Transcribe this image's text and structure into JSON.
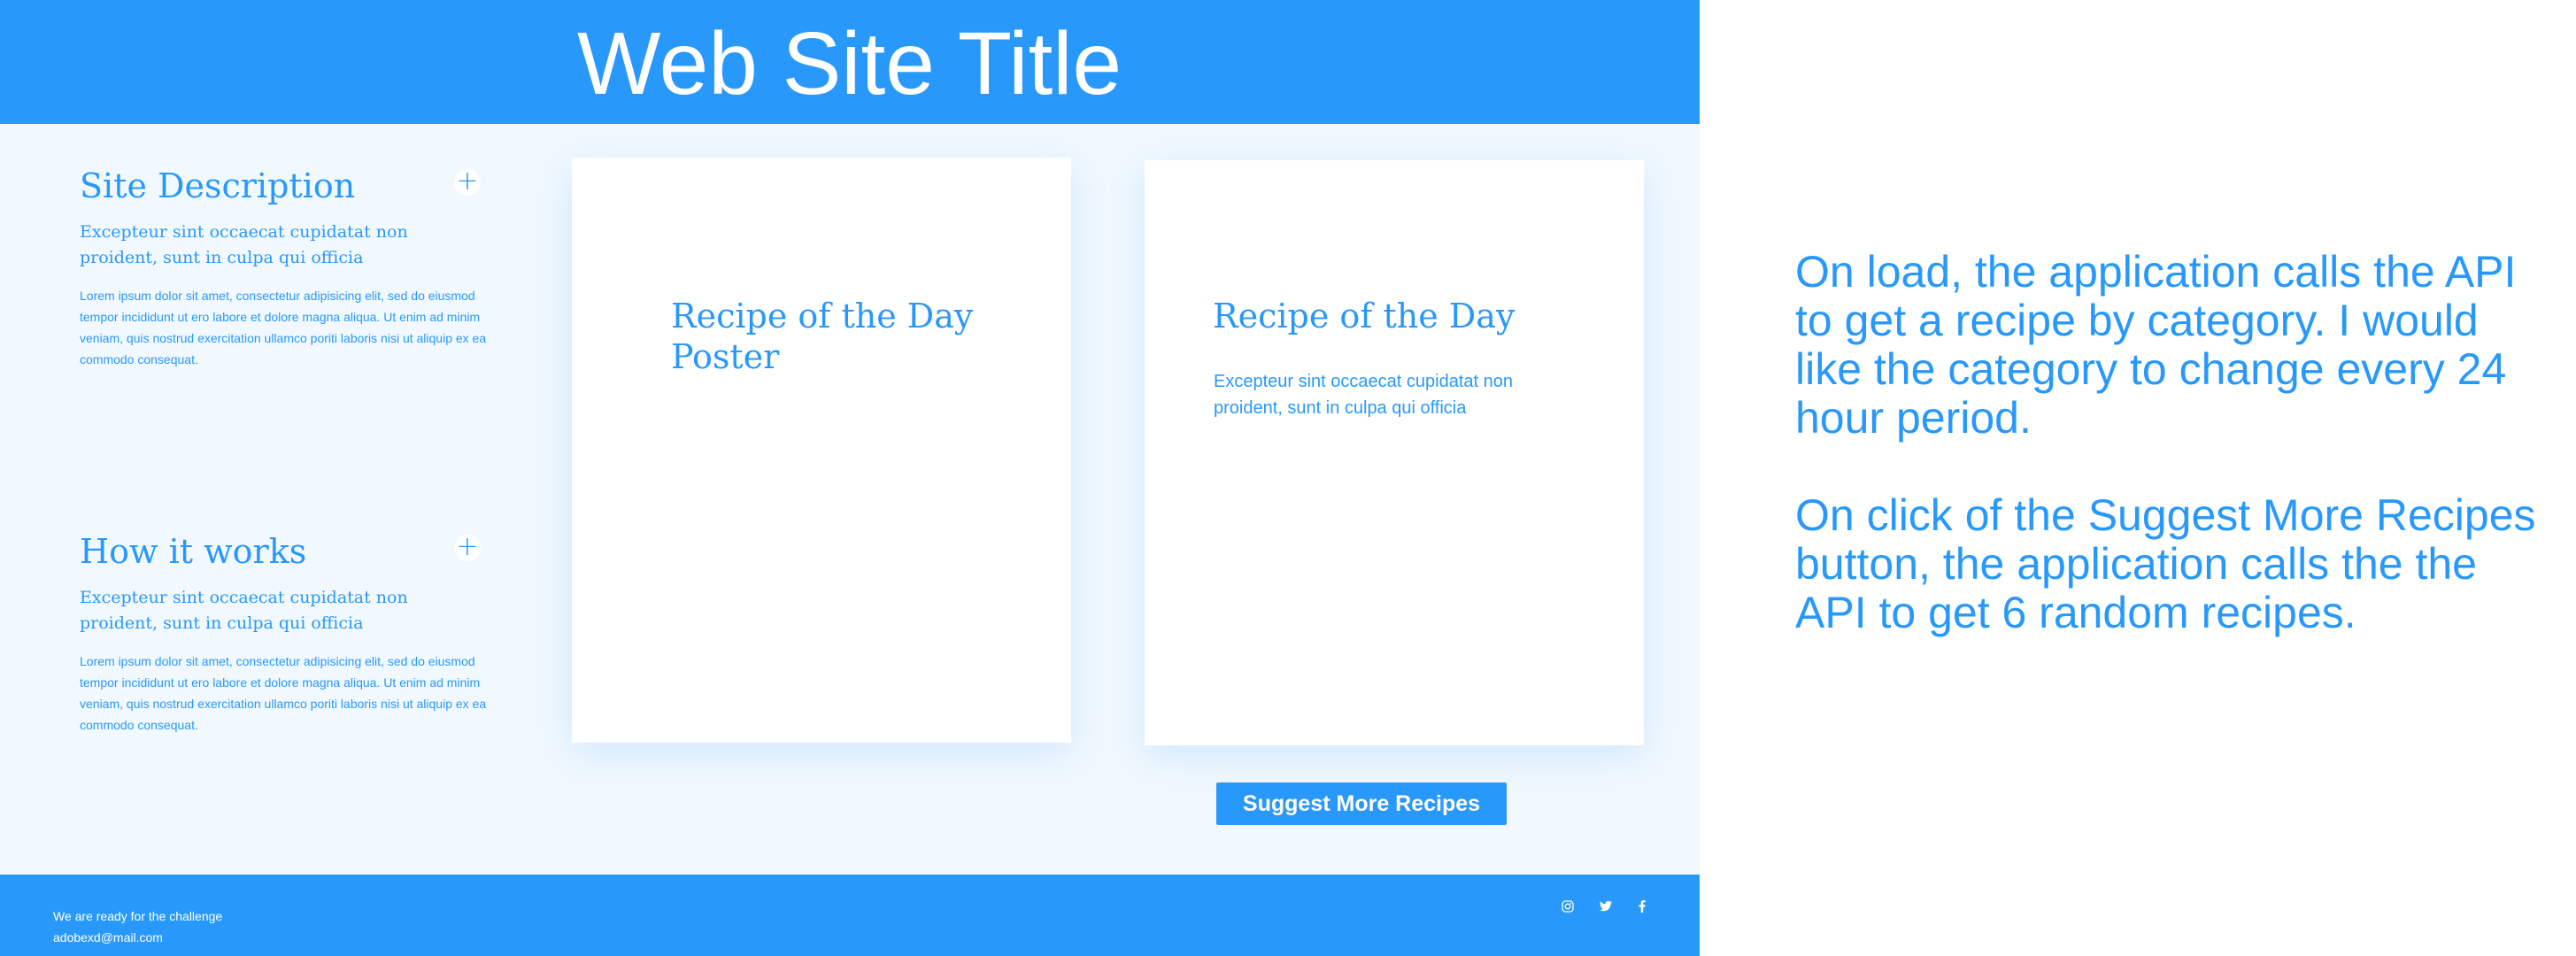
{
  "header": {
    "title": "Web Site Title"
  },
  "sidebar": {
    "site_description": {
      "heading": "Site Description",
      "subheading": "Excepteur sint occaecat cupidatat non proident, sunt in culpa qui officia",
      "body": "Lorem ipsum dolor sit amet, consectetur adipisicing elit, sed do eiusmod tempor incididunt ut ero labore et dolore magna aliqua. Ut enim ad minim veniam, quis nostrud exercitation ullamco poriti laboris nisi ut aliquip ex ea commodo consequat.",
      "expand_label": "+"
    },
    "how_it_works": {
      "heading": "How it works",
      "subheading": "Excepteur sint occaecat cupidatat non proident, sunt in culpa qui officia",
      "body": "Lorem ipsum dolor sit amet, consectetur adipisicing elit, sed do eiusmod tempor incididunt ut ero labore et dolore magna aliqua. Ut enim ad minim veniam, quis nostrud exercitation ullamco poriti laboris nisi ut aliquip ex ea commodo consequat.",
      "expand_label": "+"
    }
  },
  "poster_card": {
    "title": "Recipe of the Day Poster"
  },
  "recipe_card": {
    "title": "Recipe of the Day",
    "text": "Excepteur sint occaecat cupidatat non proident, sunt in culpa qui officia"
  },
  "actions": {
    "suggest_label": "Suggest More Recipes"
  },
  "footer": {
    "tagline": "We are ready for the challenge",
    "email": "adobexd@mail.com",
    "social": [
      "instagram-icon",
      "twitter-icon",
      "facebook-icon"
    ]
  },
  "notes": {
    "paragraph_1": "On load, the application calls the API to get a recipe by category. I would like the category to change every 24 hour period.",
    "paragraph_2": "On click of the Suggest More Recipes button, the application calls the the API to get 6 random recipes."
  },
  "colors": {
    "accent": "#2899fb",
    "page_background": "#f1f8fe",
    "card": "#ffffff"
  }
}
